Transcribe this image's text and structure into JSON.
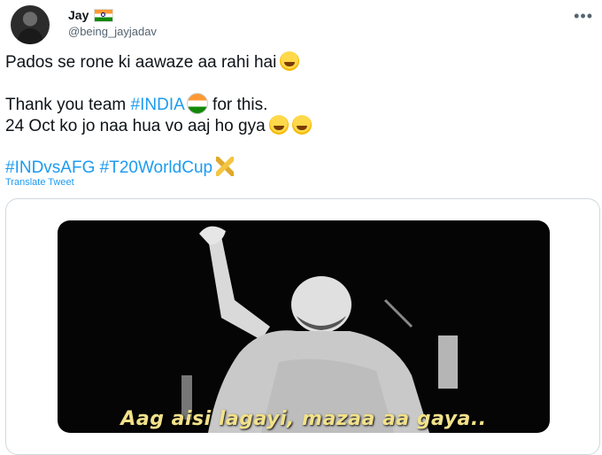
{
  "author": {
    "display_name": "Jay",
    "handle": "@being_jayjadav"
  },
  "more_icon": "more-dots-icon",
  "tweet": {
    "line1": "Pados se rone ki aawaze aa rahi hai",
    "line2_prefix": "Thank you team ",
    "line2_tag": "#INDIA",
    "line2_suffix": " for this.",
    "line3": "24 Oct ko jo naa hua vo aaj ho gya",
    "hashtag1": "#INDvsAFG",
    "hashtag2": "#T20WorldCup"
  },
  "translate_label": "Translate Tweet",
  "media": {
    "caption": "Aag aisi lagayi, mazaa aa gaya.."
  },
  "colors": {
    "link": "#1d9bf0",
    "text": "#0f1419",
    "muted": "#536471",
    "caption": "#f2e18a"
  }
}
